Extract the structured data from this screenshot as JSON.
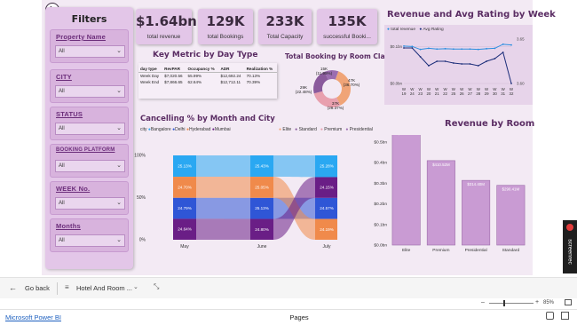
{
  "filters": {
    "title": "Filters",
    "blocks": [
      {
        "label": "Property Name",
        "value": "All"
      },
      {
        "label": "CITY",
        "value": "All"
      },
      {
        "label": "STATUS",
        "value": "All"
      },
      {
        "label": "BOOKING PLATFORM",
        "value": "All"
      },
      {
        "label": "WEEK No.",
        "value": "All"
      },
      {
        "label": "Months",
        "value": "All"
      }
    ]
  },
  "kpis": [
    {
      "value": "$1.64bn",
      "label": "total revenue"
    },
    {
      "value": "129K",
      "label": "total Bookings"
    },
    {
      "value": "233K",
      "label": "Total Capacity"
    },
    {
      "value": "135K",
      "label": "successful Booki..."
    }
  ],
  "key_metric": {
    "title": "Key Metric by Day Type",
    "headers": [
      "day type",
      "RevPAR",
      "Occupancy %",
      "ADR",
      "Realization %"
    ],
    "rows": [
      [
        "Week Day",
        "$7,020.56",
        "55.99%",
        "$12,692.24",
        "70.13%"
      ],
      [
        "Week End",
        "$7,866.65",
        "62.64%",
        "$12,712.11",
        "70.39%"
      ]
    ]
  },
  "donut": {
    "title": "Total Booking by Room Class",
    "legend": [
      "Elite",
      "Standard",
      "Premium",
      "Presidential"
    ],
    "colors": [
      "#f0a477",
      "#8a5a9c",
      "#e8a0ae",
      "#9b6db0"
    ],
    "slices": [
      {
        "label": "47K (36.70%)",
        "value": 36.7
      },
      {
        "label": "37K (28.37%)",
        "value": 28.37
      },
      {
        "label": "29K (22.48%)",
        "value": 22.48
      },
      {
        "label": "15K (11.95%)",
        "value": 11.95
      }
    ]
  },
  "rev_rating": {
    "title": "Revenue and Avg Rating by Week",
    "legend": [
      "total revenue",
      "Avg Rating"
    ],
    "y_left": [
      "$0.1bn",
      "$0.0bn"
    ],
    "y_right": [
      "3.65",
      "3.60"
    ],
    "x": [
      "W 19",
      "W 24",
      "W 23",
      "W 20",
      "W 21",
      "W 22",
      "W 25",
      "W 26",
      "W 27",
      "W 28",
      "W 29",
      "W 30",
      "W 31",
      "W 32"
    ],
    "revenue": [
      0.101,
      0.1,
      0.092,
      0.095,
      0.093,
      0.094,
      0.093,
      0.093,
      0.093,
      0.092,
      0.094,
      0.095,
      0.106,
      0.104
    ],
    "rating": [
      3.64,
      3.64,
      3.63,
      3.62,
      3.625,
      3.625,
      3.623,
      3.622,
      3.622,
      3.62,
      3.625,
      3.628,
      3.635,
      3.6
    ]
  },
  "cancel": {
    "title": "Cancelling % by Month and City",
    "legend_title": "city",
    "cities": [
      "Bangalore",
      "Delhi",
      "Hyderabad",
      "Mumbai"
    ],
    "colors": [
      "#2aa8f2",
      "#2f56d6",
      "#f08a4b",
      "#6a1e86"
    ],
    "y_ticks": [
      "100%",
      "50%",
      "0%"
    ],
    "months": [
      {
        "name": "May",
        "values": [
          25.13,
          24.79,
          24.7,
          24.64
        ]
      },
      {
        "name": "June",
        "values": [
          25.43,
          25.13,
          25.05,
          24.8
        ]
      },
      {
        "name": "July",
        "values": [
          25.28,
          24.57,
          24.19,
          24.15
        ]
      }
    ]
  },
  "rev_room": {
    "title": "Revenue by Room",
    "y_ticks": [
      "$0.5bn",
      "$0.4bn",
      "$0.3bn",
      "$0.2bn",
      "$0.1bn",
      "$0.0bn"
    ],
    "bars": [
      {
        "name": "Elite",
        "label": "$560.27M",
        "value": 0.56
      },
      {
        "name": "Premium",
        "label": "$410.52M",
        "value": 0.41
      },
      {
        "name": "Presidential",
        "label": "$314.40M",
        "value": 0.314
      },
      {
        "name": "Standard",
        "label": "$290.41M",
        "value": 0.29
      }
    ]
  },
  "nav": {
    "back_label": "Go back",
    "page_label": "Hotel And Room ..."
  },
  "status": {
    "app_link": "Microsoft Power BI",
    "pages_label": "Pages",
    "zoom": "85%"
  },
  "screenrec_label": "screenrec"
}
